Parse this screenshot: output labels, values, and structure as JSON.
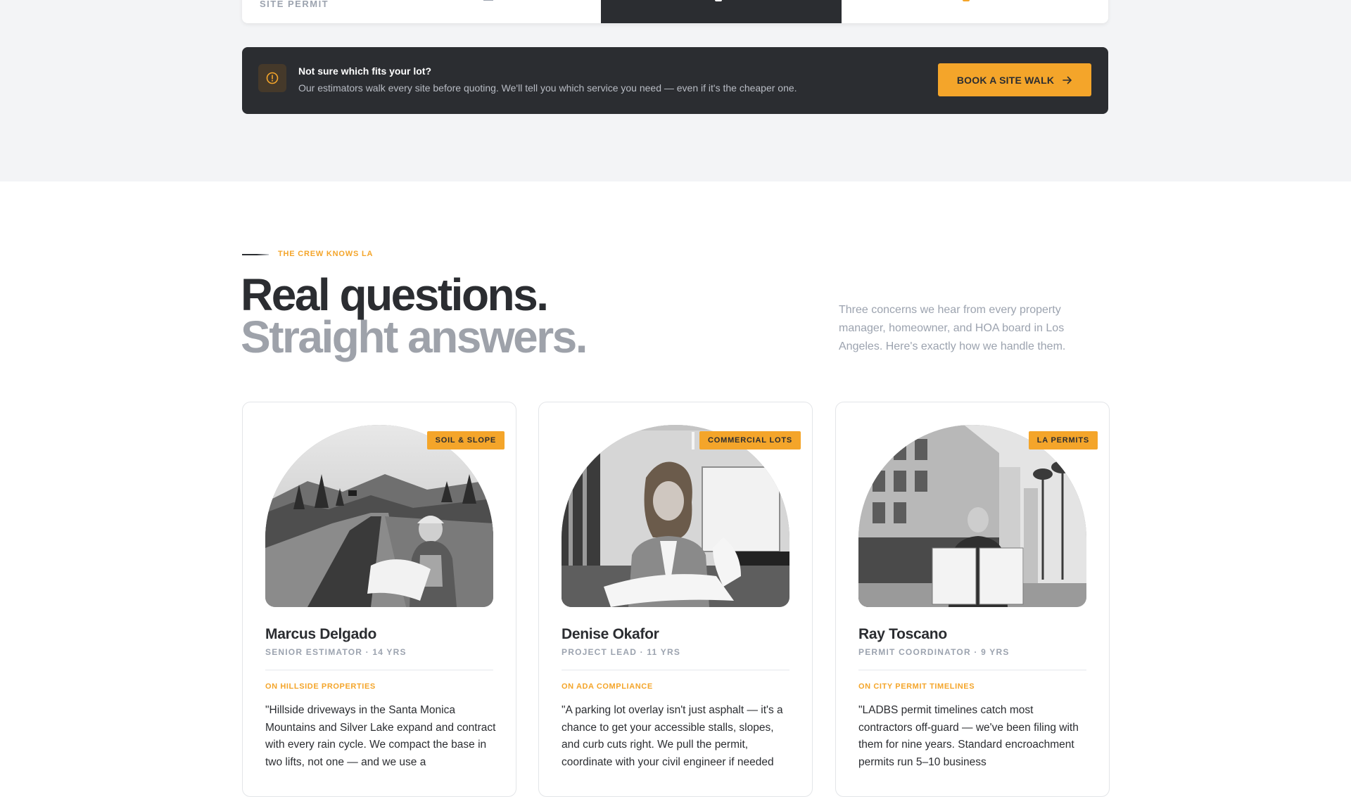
{
  "tabs": {
    "partial_label": "SITE PERMIT"
  },
  "cta": {
    "title": "Not sure which fits your lot?",
    "description": "Our estimators walk every site before quoting. We'll tell you which service you need — even if it's the cheaper one.",
    "button_label": "BOOK A SITE WALK",
    "button_icon": "arrow-right-icon",
    "info_icon": "alert-circle-icon"
  },
  "section": {
    "eyebrow": "THE CREW KNOWS LA",
    "heading_line1": "Real questions.",
    "heading_line2": "Straight answers.",
    "intro": "Three concerns we hear from every property manager, homeowner, and HOA board in Los Angeles. Here's exactly how we handle them."
  },
  "cards": [
    {
      "tag": "SOIL & SLOPE",
      "name": "Marcus Delgado",
      "role": "SENIOR ESTIMATOR · 14 YRS",
      "topic": "ON HILLSIDE PROPERTIES",
      "quote": "\"Hillside driveways in the Santa Monica Mountains and Silver Lake expand and contract with every rain cycle. We compact the base in two lifts, not one — and we use a"
    },
    {
      "tag": "COMMERCIAL LOTS",
      "name": "Denise Okafor",
      "role": "PROJECT LEAD · 11 YRS",
      "topic": "ON ADA COMPLIANCE",
      "quote": "\"A parking lot overlay isn't just asphalt — it's a chance to get your accessible stalls, slopes, and curb cuts right. We pull the permit, coordinate with your civil engineer if needed"
    },
    {
      "tag": "LA PERMITS",
      "name": "Ray Toscano",
      "role": "PERMIT COORDINATOR · 9 YRS",
      "topic": "ON CITY PERMIT TIMELINES",
      "quote": "\"LADBS permit timelines catch most contractors off-guard — we've been filing with them for nine years. Standard encroachment permits run 5–10 business"
    }
  ],
  "colors": {
    "accent": "#f4a52a",
    "dark": "#2b2d31",
    "muted": "#9ca3af"
  }
}
